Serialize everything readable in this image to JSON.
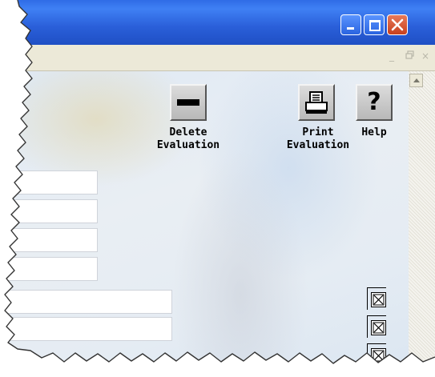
{
  "window": {
    "caption_buttons": {
      "minimize": "minimize-icon",
      "maximize": "maximize-icon",
      "close": "close-icon"
    },
    "mdi_controls": [
      "_",
      "̈",
      "×"
    ],
    "colors": {
      "titlebar": "#2a5fd9",
      "close_button": "#c8401d",
      "mdi_bar": "#ece9d8"
    }
  },
  "toolbar": {
    "delete": {
      "line1": "Delete",
      "line2": "Evaluation",
      "icon": "minus-icon"
    },
    "print": {
      "line1": "Print",
      "line2": "Evaluation",
      "icon": "printer-icon"
    },
    "help": {
      "label": "Help",
      "icon": "question-mark-icon"
    }
  },
  "form": {
    "short_fields": [
      "",
      "",
      "",
      ""
    ],
    "long_fields": [
      "",
      ""
    ],
    "checkboxes": [
      true,
      true,
      true
    ]
  }
}
